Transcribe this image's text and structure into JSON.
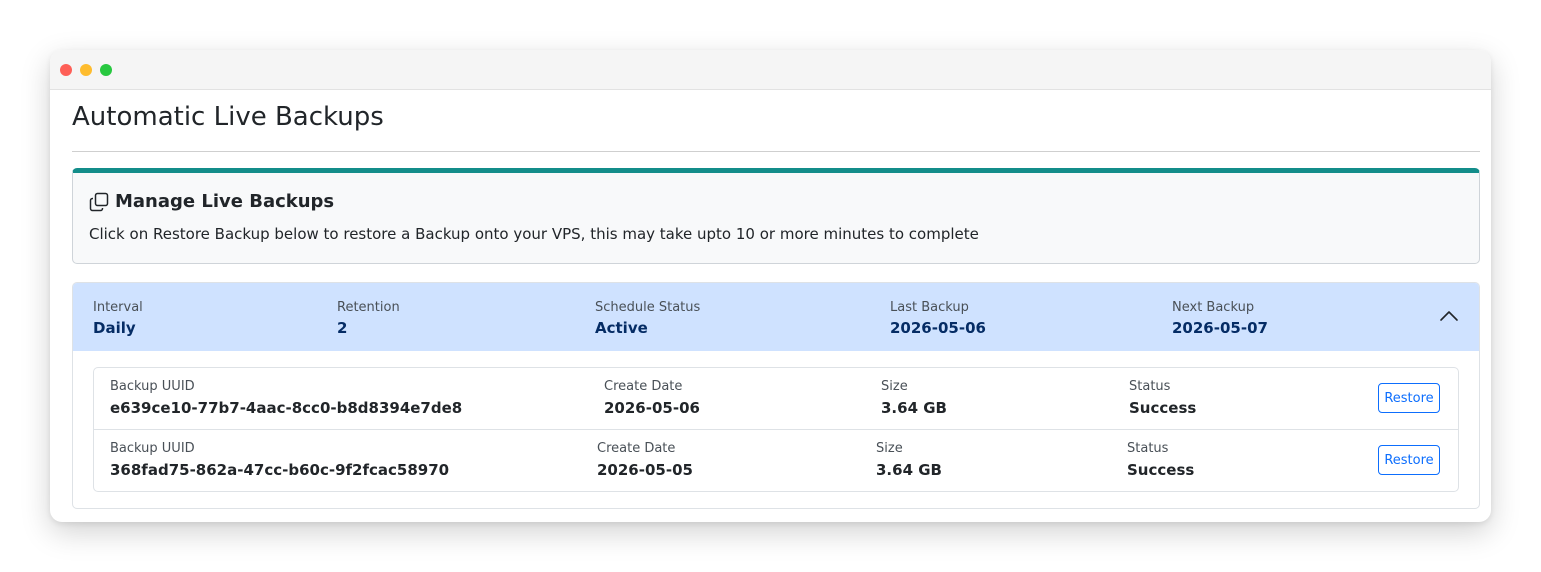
{
  "page": {
    "title": "Automatic Live Backups"
  },
  "manage": {
    "title": "Manage Live Backups",
    "description": "Click on Restore Backup below to restore a Backup onto your VPS, this may take upto 10 or more minutes to complete",
    "icon": "copy-icon",
    "accent_color": "#138d8a"
  },
  "schedule": {
    "interval_label": "Interval",
    "interval_value": "Daily",
    "retention_label": "Retention",
    "retention_value": "2",
    "status_label": "Schedule Status",
    "status_value": "Active",
    "last_label": "Last Backup",
    "last_value": "2026-05-06",
    "next_label": "Next Backup",
    "next_value": "2026-05-07",
    "expanded": true,
    "header_color": "#cfe2ff"
  },
  "backups": [
    {
      "uuid_label": "Backup UUID",
      "uuid": "e639ce10-77b7-4aac-8cc0-b8d8394e7de8",
      "date_label": "Create Date",
      "date": "2026-05-06",
      "size_label": "Size",
      "size": "3.64 GB",
      "status_label": "Status",
      "status": "Success",
      "action": "Restore"
    },
    {
      "uuid_label": "Backup UUID",
      "uuid": "368fad75-862a-47cc-b60c-9f2fcac58970",
      "date_label": "Create Date",
      "date": "2026-05-05",
      "size_label": "Size",
      "size": "3.64 GB",
      "status_label": "Status",
      "status": "Success",
      "action": "Restore"
    }
  ]
}
